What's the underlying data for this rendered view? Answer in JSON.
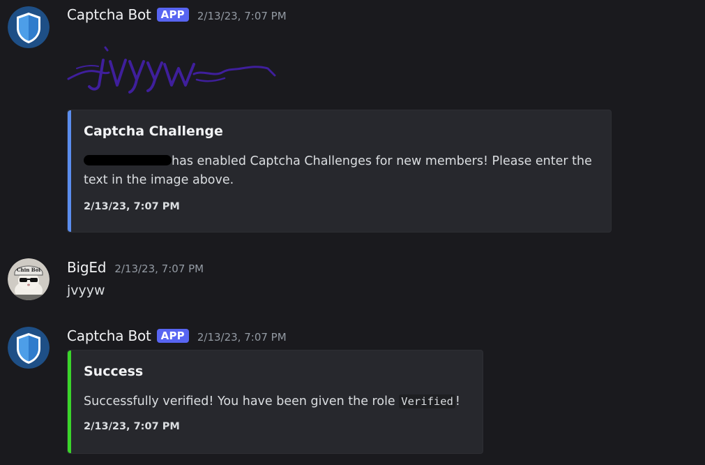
{
  "messages": [
    {
      "username": "Captcha Bot",
      "badge": "APP",
      "timestamp": "2/13/23, 7:07 PM",
      "captcha_image_text": "jvyyw",
      "embed": {
        "title": "Captcha Challenge",
        "desc_rest": "has enabled Captcha Challenges for new members! Please enter the text in the image above.",
        "footer": "2/13/23, 7:07 PM",
        "accent_color": "#5b8dee"
      }
    },
    {
      "username": "BigEd",
      "timestamp": "2/13/23, 7:07 PM",
      "content": "jvyyw",
      "avatar_text": "Chin Boi"
    },
    {
      "username": "Captcha Bot",
      "badge": "APP",
      "timestamp": "2/13/23, 7:07 PM",
      "embed": {
        "title": "Success",
        "desc_before": "Successfully verified! You have been given the role ",
        "desc_code": "Verified",
        "desc_after": "!",
        "footer": "2/13/23, 7:07 PM",
        "accent_color": "#3ad52a"
      }
    }
  ],
  "colors": {
    "background": "#1a1a1e",
    "embed_background": "#27282d",
    "badge": "#5865f2",
    "username": "#f2f3f5",
    "timestamp": "#949ba4"
  },
  "icons": {
    "bot_avatar": "shield-icon",
    "user_avatar": "cat-with-hat-avatar"
  }
}
